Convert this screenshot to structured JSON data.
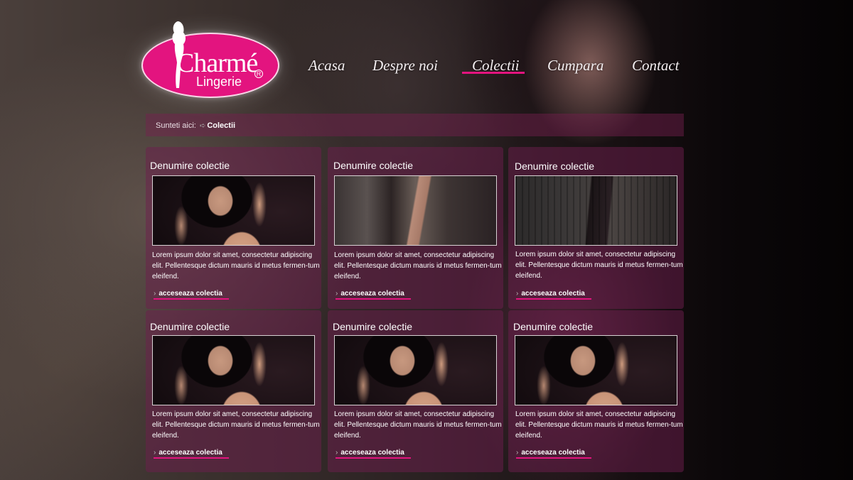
{
  "brand": {
    "name": "Charmé",
    "sub": "Lingerie",
    "reg": "R",
    "color": "#e3147f"
  },
  "nav": {
    "items": [
      {
        "label": "Acasa"
      },
      {
        "label": "Despre noi"
      },
      {
        "label": "Colectii",
        "active": true
      },
      {
        "label": "Cumpara"
      },
      {
        "label": "Contact"
      }
    ]
  },
  "breadcrumb": {
    "prefix": "Sunteti aici:",
    "current": "Colectii"
  },
  "cards": [
    {
      "title": "Denumire colectie",
      "image": "model-portrait-photo",
      "text": "Lorem ipsum dolor sit amet, consectetur adipiscing elit. Pellentesque dictum mauris id metus fermen-tum eleifend.",
      "link": "acceseaza colectia"
    },
    {
      "title": "Denumire colectie",
      "image": "legs-stockings-photo",
      "text": "Lorem ipsum dolor sit amet, consectetur adipiscing elit. Pellentesque dictum mauris id metus fermen-tum eleifend.",
      "link": "acceseaza colectia"
    },
    {
      "title": "Denumire colectie",
      "image": "lace-stockings-photo",
      "text": "Lorem ipsum dolor sit amet, consectetur adipiscing elit. Pellentesque dictum mauris id metus fermen-tum eleifend.",
      "link": "acceseaza colectia"
    },
    {
      "title": "Denumire colectie",
      "image": "model-portrait-photo",
      "text": "Lorem ipsum dolor sit amet, consectetur adipiscing elit. Pellentesque dictum mauris id metus fermen-tum eleifend.",
      "link": "acceseaza colectia"
    },
    {
      "title": "Denumire colectie",
      "image": "model-portrait-photo",
      "text": "Lorem ipsum dolor sit amet, consectetur adipiscing elit. Pellentesque dictum mauris id metus fermen-tum eleifend.",
      "link": "acceseaza colectia"
    },
    {
      "title": "Denumire colectie",
      "image": "model-portrait-photo",
      "text": "Lorem ipsum dolor sit amet, consectetur adipiscing elit. Pellentesque dictum mauris id metus fermen-tum eleifend.",
      "link": "acceseaza colectia"
    }
  ]
}
